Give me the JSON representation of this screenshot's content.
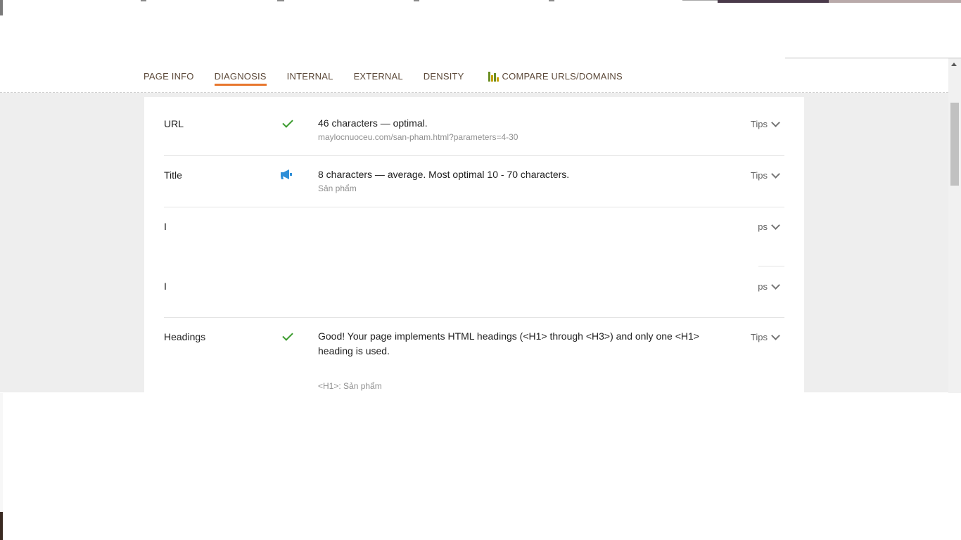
{
  "tabs": [
    {
      "label": "PAGE INFO"
    },
    {
      "label": "DIAGNOSIS"
    },
    {
      "label": "INTERNAL"
    },
    {
      "label": "EXTERNAL"
    },
    {
      "label": "DENSITY"
    },
    {
      "label": "COMPARE URLS/DOMAINS"
    }
  ],
  "rows": [
    {
      "label": "URL",
      "status": "check-icon",
      "message": "46 characters — optimal.",
      "detail": "maylocnuoceu.com/san-pham.html?parameters=4-30",
      "tips": "Tips"
    },
    {
      "label": "Title",
      "status": "megaphone-icon",
      "message": "8 characters — average. Most optimal 10 - 70 characters.",
      "detail": "Sản phẩm",
      "tips": "Tips"
    },
    {
      "label": "I",
      "tips": "ps"
    },
    {
      "label": "I",
      "tips": "ps"
    },
    {
      "label": "Headings",
      "status": "check-icon",
      "message": "Good! Your page implements HTML headings (<H1> through <H3>) and only one <H1> heading is used.",
      "detail": "<H1>: Sản phẩm",
      "tips": "Tips"
    }
  ],
  "colors": {
    "accent": "#e8772e",
    "success": "#3a9b2d",
    "info": "#2f8fd8"
  }
}
